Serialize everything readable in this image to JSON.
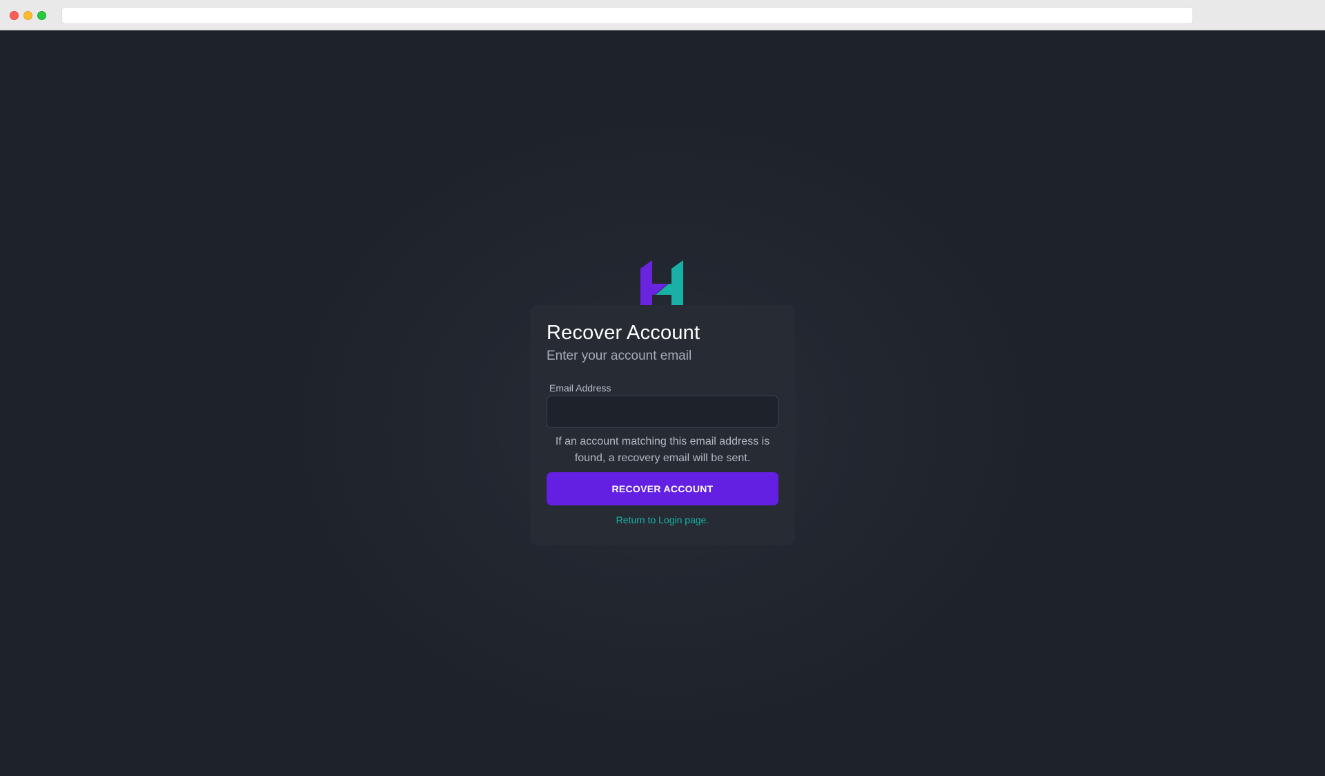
{
  "browser": {
    "url": ""
  },
  "logo": {
    "name": "hive-logo-icon",
    "colors": {
      "left": "#6a24e0",
      "right": "#19b0a5"
    }
  },
  "recover": {
    "title": "Recover Account",
    "subtitle": "Enter your account email",
    "email_label": "Email Address",
    "email_value": "",
    "email_placeholder": "",
    "helper_text": "If an account matching this email address is found, a recovery email will be sent.",
    "submit_label": "RECOVER ACCOUNT",
    "login_link": "Return to Login page."
  },
  "theme": {
    "background": "#1e222a",
    "card": "#262b34",
    "accent": "#6320e3",
    "link": "#19b4a6"
  }
}
